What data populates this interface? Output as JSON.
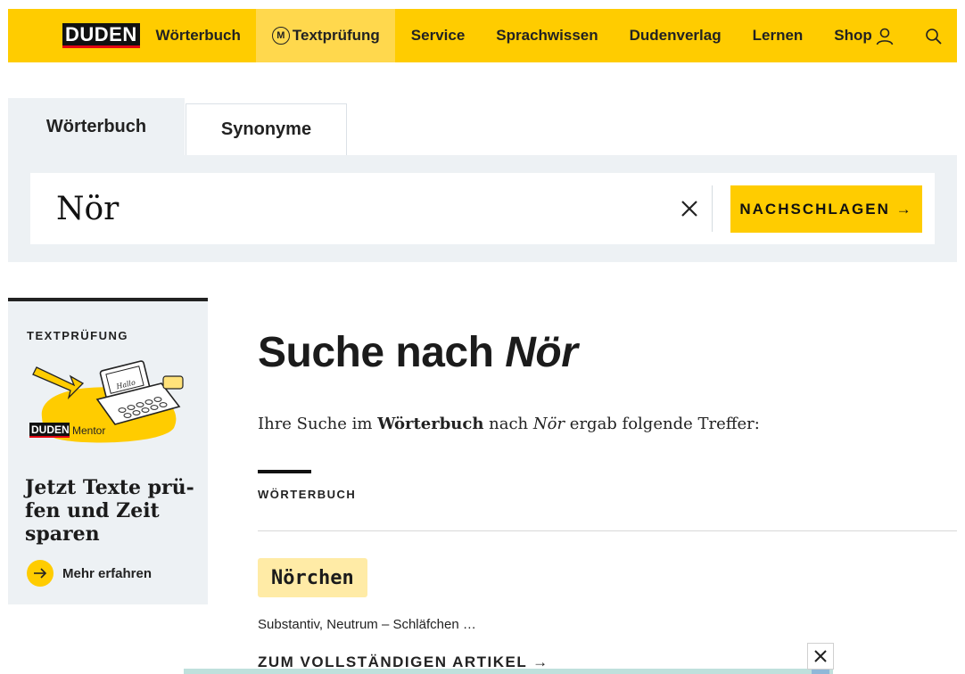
{
  "header": {
    "logo_text": "DUDEN",
    "nav": [
      {
        "label": "Wörterbuch",
        "active": false
      },
      {
        "label": "Textprüfung",
        "active": true,
        "badge": "M"
      },
      {
        "label": "Service",
        "active": false
      },
      {
        "label": "Sprachwissen",
        "active": false
      },
      {
        "label": "Dudenverlag",
        "active": false
      },
      {
        "label": "Lernen",
        "active": false
      },
      {
        "label": "Shop",
        "active": false
      }
    ],
    "icons": [
      "user-icon",
      "search-icon"
    ],
    "accent_color": "#ffcc00"
  },
  "search": {
    "tabs": [
      {
        "label": "Wörterbuch",
        "active": true
      },
      {
        "label": "Synonyme",
        "active": false
      }
    ],
    "query": "Nör",
    "submit_label": "NACHSCHLAGEN →"
  },
  "promo": {
    "kicker": "TEXTPRÜFUNG",
    "logo_text": "DUDEN",
    "logo_suffix": "Mentor",
    "sticker_text": "Hallo",
    "headline": "Jetzt Texte prü­fen und Zeit sparen",
    "link_label": "Mehr erfahren"
  },
  "main": {
    "title_prefix": "Suche nach ",
    "title_query": "Nör",
    "intro_1": "Ihre Suche im ",
    "intro_bold": "Wörterbuch",
    "intro_2": " nach ",
    "intro_query": "Nör",
    "intro_3": " ergab folgende Treffer:",
    "section_label": "WÖRTERBUCH",
    "results": [
      {
        "word": "Nörchen",
        "meta": "Substantiv, Neutrum – Schläfchen …",
        "link_label": "ZUM VOLLSTÄNDIGEN ARTIKEL →"
      }
    ]
  }
}
